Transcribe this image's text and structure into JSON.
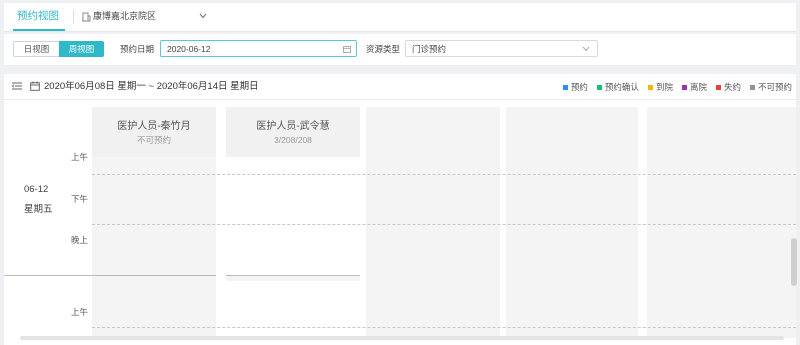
{
  "header": {
    "active_tab": "预约视图",
    "organization": "康博嘉北京院区"
  },
  "filters": {
    "view_day": "日视图",
    "view_week": "周视图",
    "date_label": "预约日期",
    "date_value": "2020-06-12",
    "resource_type_label": "资源类型",
    "resource_type_value": "门诊预约"
  },
  "range": {
    "text": "2020年06月08日 星期一 ~ 2020年06月14日 星期日"
  },
  "legend": [
    {
      "label": "预约",
      "color": "#2d8cf0"
    },
    {
      "label": "预约确认",
      "color": "#19be6b"
    },
    {
      "label": "到院",
      "color": "#f5b800"
    },
    {
      "label": "离院",
      "color": "#9b30b0"
    },
    {
      "label": "失约",
      "color": "#e8413b"
    },
    {
      "label": "不可预约",
      "color": "#909399"
    }
  ],
  "resources": [
    {
      "name": "医护人员-秦竹月",
      "status": "不可预约"
    },
    {
      "name": "医护人员-武令慧",
      "status": "3/208/208"
    }
  ],
  "day": {
    "date": "06-12",
    "weekday": "星期五",
    "periods": [
      "上午",
      "下午",
      "晚上"
    ]
  },
  "next_day": {
    "periods": [
      "上午"
    ]
  }
}
